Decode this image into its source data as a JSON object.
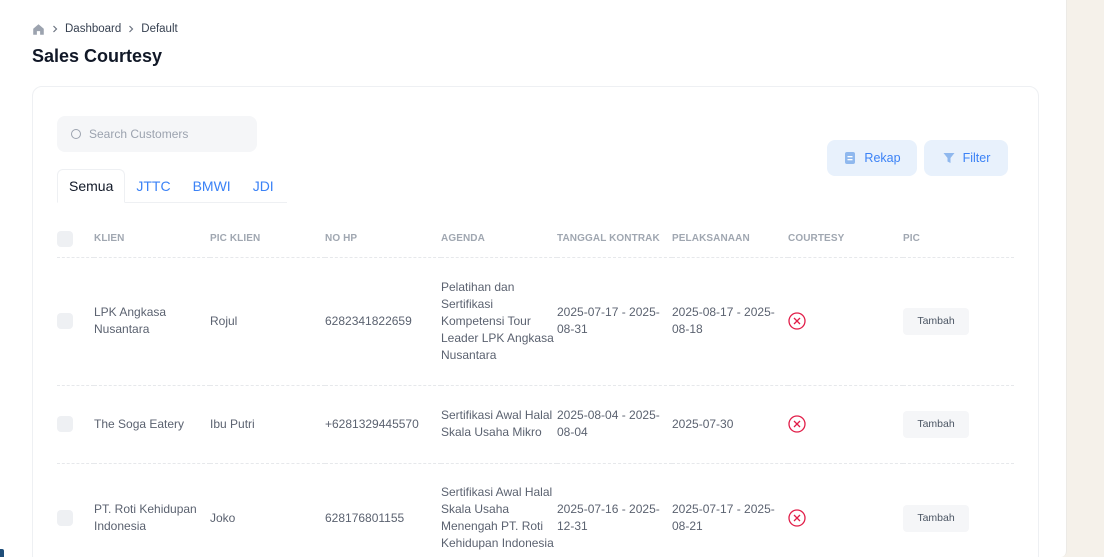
{
  "breadcrumb": {
    "items": [
      "Dashboard",
      "Default"
    ]
  },
  "page_title": "Sales Courtesy",
  "search": {
    "placeholder": "Search Customers",
    "value": ""
  },
  "tabs": [
    {
      "label": "Semua",
      "active": true
    },
    {
      "label": "JTTC",
      "active": false
    },
    {
      "label": "BMWI",
      "active": false
    },
    {
      "label": "JDI",
      "active": false
    }
  ],
  "actions": {
    "rekap_label": "Rekap",
    "filter_label": "Filter"
  },
  "table": {
    "columns": [
      "KLIEN",
      "PIC KLIEN",
      "NO HP",
      "AGENDA",
      "TANGGAL KONTRAK",
      "PELAKSANAAN",
      "COURTESY",
      "PIC"
    ],
    "rows": [
      {
        "klien": "LPK Angkasa Nusantara",
        "pic_klien": "Rojul",
        "no_hp": "6282341822659",
        "agenda": "Pelatihan dan Sertifikasi Kompetensi Tour Leader LPK Angkasa Nusantara",
        "tanggal_kontrak": "2025-07-17 - 2025-08-31",
        "pelaksanaan": "2025-08-17 - 2025-08-18",
        "courtesy_icon": "x-circle-icon",
        "pic_button": "Tambah"
      },
      {
        "klien": "The Soga Eatery",
        "pic_klien": "Ibu Putri",
        "no_hp": "+6281329445570",
        "agenda": "Sertifikasi Awal Halal Skala Usaha Mikro",
        "tanggal_kontrak": "2025-08-04 - 2025-08-04",
        "pelaksanaan": "2025-07-30",
        "courtesy_icon": "x-circle-icon",
        "pic_button": "Tambah"
      },
      {
        "klien": "PT. Roti Kehidupan Indonesia",
        "pic_klien": "Joko",
        "no_hp": "628176801155",
        "agenda": "Sertifikasi Awal Halal Skala Usaha Menengah PT. Roti Kehidupan Indonesia",
        "tanggal_kontrak": "2025-07-16 - 2025-12-31",
        "pelaksanaan": "2025-07-17 - 2025-08-21",
        "courtesy_icon": "x-circle-icon",
        "pic_button": "Tambah"
      }
    ]
  },
  "colors": {
    "accent": "#3b82f6",
    "button_bg": "#e8f1fc",
    "status_red": "#e11d48",
    "page_bg": "#f5f1ea"
  }
}
